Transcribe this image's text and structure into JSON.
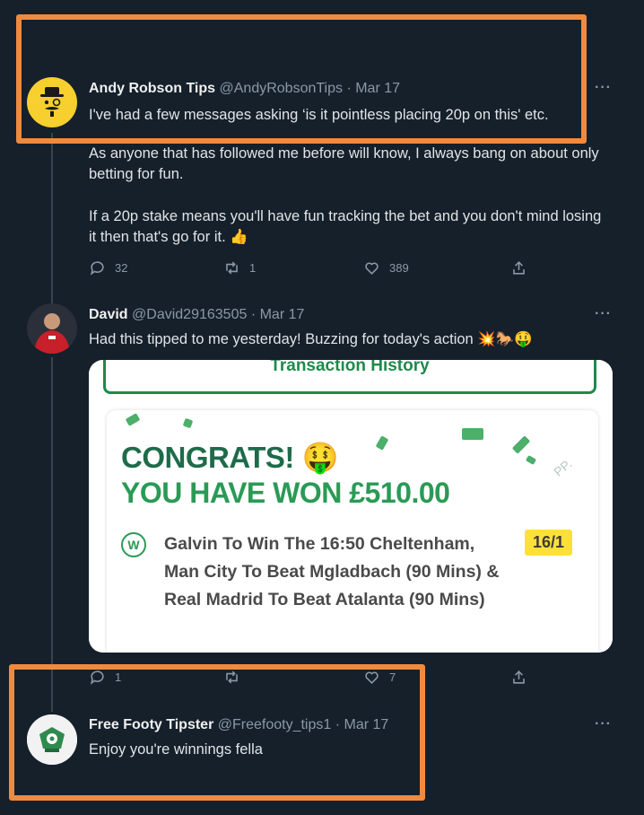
{
  "tweets": [
    {
      "name": "Andy Robson Tips",
      "handle": "@AndyRobsonTips",
      "date": "· Mar 17",
      "more": "···",
      "lines": [
        "I've had a few messages asking ‘is it pointless placing 20p on this' etc.",
        "As anyone that has followed me before will know, I always bang on about only betting for fun.",
        "If a 20p stake means you'll have fun tracking the bet and you don't mind losing it then that's go for it. 👍"
      ],
      "actions": {
        "reply": "32",
        "retweet": "1",
        "like": "389"
      }
    },
    {
      "name": "David",
      "handle": "@David29163505",
      "date": "· Mar 17",
      "more": "···",
      "text": "Had this tipped to me yesterday! Buzzing for today's action 💥🐎🤑",
      "card": {
        "header": "Transaction History",
        "congrats": "CONGRATS! 🤑",
        "won": "YOU HAVE WON £510.00",
        "badge": "W",
        "bet": "Galvin To Win The 16:50 Cheltenham, Man City To Beat Mgladbach (90 Mins) & Real Madrid To Beat Atalanta (90 Mins)",
        "odds": "16/1",
        "watermark": "PP."
      },
      "actions": {
        "reply": "1",
        "retweet": "",
        "like": "7"
      }
    },
    {
      "name": "Free Footy Tipster",
      "handle": "@Freefooty_tips1",
      "date": "· Mar 17",
      "more": "···",
      "text": "Enjoy you're winnings fella"
    }
  ],
  "colors": {
    "background": "#15202b",
    "highlight": "#f08a3e",
    "accent_green": "#2a9a55",
    "odds_yellow": "#ffe03a"
  }
}
